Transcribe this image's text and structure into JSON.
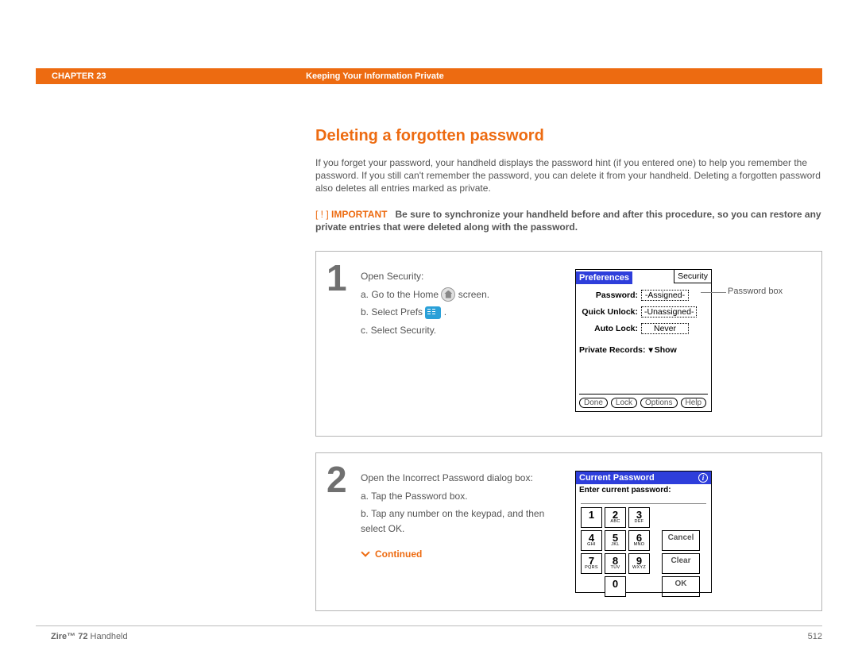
{
  "header": {
    "chapter": "CHAPTER 23",
    "section": "Keeping Your Information Private"
  },
  "title": "Deleting a forgotten password",
  "intro": "If you forget your password, your handheld displays the password hint (if you entered one) to help you remember the password. If you still can't remember the password, you can delete it from your handheld. Deleting a forgotten password also deletes all entries marked as private.",
  "important": {
    "tag": "IMPORTANT",
    "text": "Be sure to synchronize your handheld before and after this procedure, so you can restore any private entries that were deleted along with the password."
  },
  "step1": {
    "num": "1",
    "lead": "Open Security:",
    "a_pre": "a.  Go to the Home ",
    "a_post": " screen.",
    "b_pre": "b.  Select Prefs ",
    "b_post": ".",
    "c": "c.  Select Security.",
    "prefs": {
      "title": "Preferences",
      "tab": "Security",
      "pw_lbl": "Password:",
      "pw_val": "-Assigned-",
      "qu_lbl": "Quick Unlock:",
      "qu_val": "-Unassigned-",
      "al_lbl": "Auto Lock:",
      "al_val": "Never",
      "pr_lbl": "Private Records:",
      "pr_val": "Show",
      "btns": {
        "done": "Done",
        "lock": "Lock",
        "options": "Options",
        "help": "Help"
      },
      "callout": "Password box"
    }
  },
  "step2": {
    "num": "2",
    "lead": "Open the Incorrect Password dialog box:",
    "a": "a.  Tap the Password box.",
    "b": "b.  Tap any number on the keypad, and then select OK.",
    "pw": {
      "title": "Current Password",
      "prompt": "Enter current password:",
      "keys": [
        {
          "n": "1",
          "s": ""
        },
        {
          "n": "2",
          "s": "ABC"
        },
        {
          "n": "3",
          "s": "DEF"
        },
        {
          "n": "4",
          "s": "GHI"
        },
        {
          "n": "5",
          "s": "JKL"
        },
        {
          "n": "6",
          "s": "MNO"
        },
        {
          "n": "7",
          "s": "PQRS"
        },
        {
          "n": "8",
          "s": "TUV"
        },
        {
          "n": "9",
          "s": "WXYZ"
        },
        {
          "n": "0",
          "s": ""
        }
      ],
      "cancel": "Cancel",
      "clear": "Clear",
      "ok": "OK"
    }
  },
  "continued": "Continued",
  "footer": {
    "product_strong": "Zire™ 72",
    "product_rest": " Handheld",
    "page": "512"
  }
}
